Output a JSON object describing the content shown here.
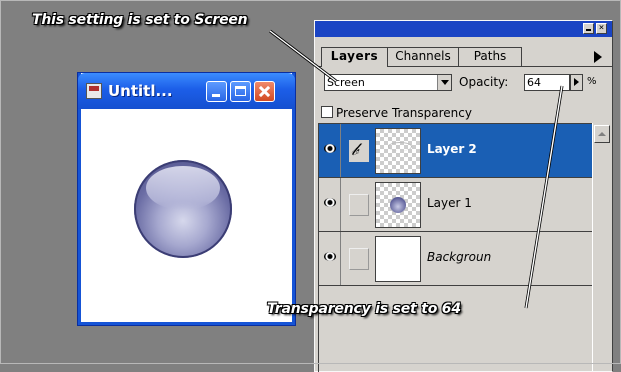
{
  "annotations": {
    "top": "This setting is set to Screen",
    "bottom": "Transparency is set to 64"
  },
  "document_window": {
    "title": "Untitl...",
    "colors": {
      "title_bar": "#1c5ee8",
      "close_button": "#d24a22"
    }
  },
  "layers_palette": {
    "tabs": [
      {
        "label": "Layers",
        "active": true
      },
      {
        "label": "Channels",
        "active": false
      },
      {
        "label": "Paths",
        "active": false
      }
    ],
    "blend_mode": "Screen",
    "opacity_label": "Opacity:",
    "opacity_value": "64",
    "percent_sign": "%",
    "preserve_transparency_label": "Preserve Transparency",
    "preserve_transparency_checked": false,
    "layers": [
      {
        "name": "Layer 2",
        "visible": true,
        "selected": true,
        "brush_icon": "paintbrush-icon"
      },
      {
        "name": "Layer 1",
        "visible": true,
        "selected": false
      },
      {
        "name": "Backgroun",
        "visible": true,
        "selected": false,
        "italic": true
      }
    ],
    "colors": {
      "selected_row": "#1a5fb4",
      "title_bar": "#1a44c4",
      "panel": "#d6d3ce"
    }
  }
}
